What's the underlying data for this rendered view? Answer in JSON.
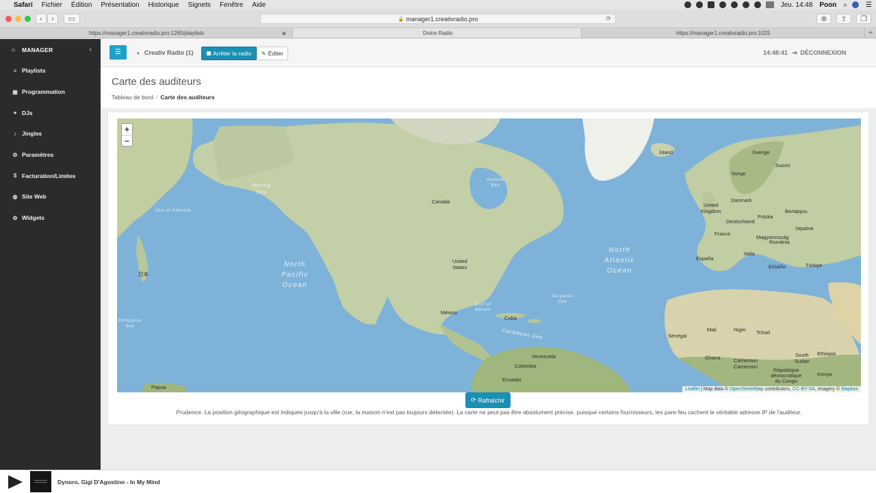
{
  "menubar": {
    "app": "Safari",
    "items": [
      "Fichier",
      "Édition",
      "Présentation",
      "Historique",
      "Signets",
      "Fenêtre",
      "Aide"
    ],
    "clock": "Jeu. 14:48",
    "user": "Poon"
  },
  "browser": {
    "url": "manager1.creativradio.pro",
    "tabs": [
      {
        "label": "https://manager1.creativradio.pro:1265/playlists"
      },
      {
        "label": "Dolce Radio"
      },
      {
        "label": "https://manager1.creativradio.pro:1025"
      }
    ]
  },
  "sidebar": {
    "brand": "MANAGER",
    "items": [
      {
        "label": "Playlists",
        "icon": "list-icon"
      },
      {
        "label": "Programmation",
        "icon": "calendar-icon"
      },
      {
        "label": "DJs",
        "icon": "user-icon"
      },
      {
        "label": "Jingles",
        "icon": "bell-icon"
      },
      {
        "label": "Paramètres",
        "icon": "cogs-icon"
      },
      {
        "label": "Facturation/Limites",
        "icon": "dollar-icon"
      },
      {
        "label": "Site Web",
        "icon": "globe-icon"
      },
      {
        "label": "Widgets",
        "icon": "gift-icon"
      }
    ]
  },
  "topbar": {
    "radio_name": "Creativ Radio (1)",
    "stop_label": "Arrêter la radio",
    "edit_label": "Éditer",
    "time": "14:48:41",
    "logout_label": "DÉCONNEXION"
  },
  "page": {
    "title": "Carte des auditeurs",
    "breadcrumb_home": "Tableau de bord",
    "breadcrumb_current": "Carte des auditeurs"
  },
  "map": {
    "zoom_in": "+",
    "zoom_out": "−",
    "attribution": {
      "leaflet": "Leaflet",
      "map_data": "| Map data ©",
      "osm": "OpenStreetMap",
      "contributors": "contributors,",
      "license": "CC-BY-SA",
      "imagery": ", Imagery ©",
      "mapbox": "Mapbox"
    },
    "labels": {
      "canada": "Canada",
      "united_states": "United\nStates",
      "mexico": "México",
      "cuba": "Cuba",
      "venezuela": "Venezuela",
      "colombia": "Colombia",
      "ecuador": "Ecuador",
      "island": "Ísland",
      "sverige": "Sverige",
      "suomi": "Suomi",
      "norge": "Norge",
      "danmark": "Danmark",
      "uk": "United\nKingdom",
      "deutschland": "Deutschland",
      "polska": "Polska",
      "france": "France",
      "espana": "España",
      "italia": "Italia",
      "romania": "România",
      "magyarorszag": "Magyarország",
      "ukraina": "Україна",
      "belarus": "Беларусь",
      "turkiye": "Türkiye",
      "ellada": "Ελλάδα",
      "mali": "Mali",
      "niger": "Niger",
      "tchad": "Tchad",
      "senegal": "Sénégal",
      "ghana": "Ghana",
      "cameroun": "Cameroun\nCameroon",
      "south_sudan": "South\nSudan",
      "ethiopia": "Ethiopia",
      "kenya": "Kenya",
      "rdc": "République\ndémocratique\ndu Congo",
      "japan": "日本",
      "papua": "Papua",
      "north_pacific": "North\nPacific\nOcean",
      "north_atlantic": "North\nAtlantic\nOcean",
      "bering": "Bering\nSea",
      "caribbean": "Caribbean Sea",
      "gulf_mexico": "Gulf of\nMexico",
      "hudson": "Hudson\nBay",
      "okhotsk": "Sea of Okhotsk",
      "sargasso": "Sargasso\nSea",
      "philippine": "Philippine\nSea"
    }
  },
  "refresh_label": "Rafraîchir",
  "notice": "Prudence. La position géographique est indiquée jusqu'à la ville (rue, la maison n'est pas toujours détectée). La carte ne peut pas être absolument précise, puisque certains fournisseurs, les pare-feu cachent la véritable adresse IP de l'auditeur.",
  "player": {
    "now_playing": "Dynoro, Gigi D'Agostino - In My Mind"
  },
  "colors": {
    "primary": "#1b8fb4",
    "sidebar": "#2a2b2d",
    "ocean": "#7fb3d9",
    "land": "#b9c8a0"
  }
}
